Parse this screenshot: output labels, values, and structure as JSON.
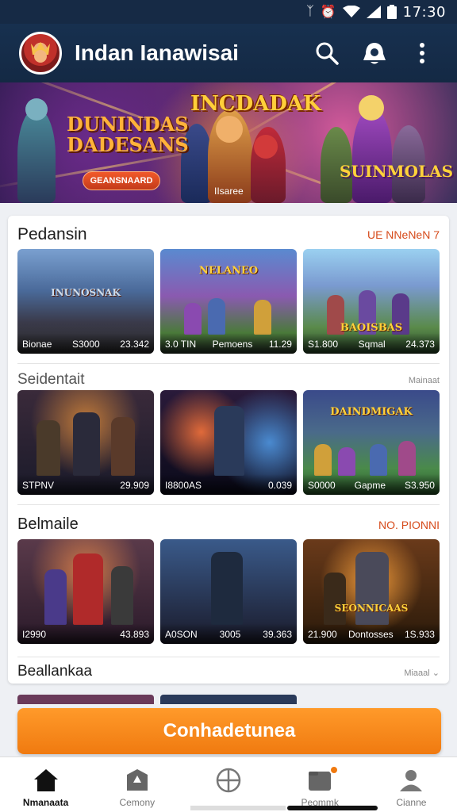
{
  "status": {
    "time": "17:30",
    "icons": [
      "bluetooth-icon",
      "alarm-icon",
      "wifi-icon",
      "signal-icon",
      "battery-icon"
    ]
  },
  "appbar": {
    "title": "Indan Ianawisai",
    "icons": [
      "search-icon",
      "notification-icon",
      "more-icon"
    ]
  },
  "banner": {
    "headline": "INCDADAK",
    "left_title": [
      "DUNINDAS",
      "DADESANS"
    ],
    "right_title": "SUINMOLAS",
    "button_label": "GEANSNAARD",
    "caption": "IIsaree"
  },
  "sections": [
    {
      "title": "Pedansin",
      "link": "UE NNeNeN 7",
      "tiles": [
        {
          "logo": "INUNOSNAK",
          "left": "Bionae",
          "mid": "S3000",
          "right": "23.342"
        },
        {
          "logo": "NELANEO",
          "left": "3.0 TIN",
          "mid": "Pemoens",
          "right": "11.29"
        },
        {
          "logo": "BAOISBAS",
          "left": "S1.800",
          "mid": "Sqmal",
          "right": "24.373"
        }
      ]
    },
    {
      "title": "Seidentait",
      "link": "Mainaat",
      "tiles": [
        {
          "logo": "",
          "left": "STPNV",
          "mid": "",
          "right": "29.909"
        },
        {
          "logo": "",
          "left": "I8800AS",
          "mid": "",
          "right": "0.039"
        },
        {
          "logo": "DAINDMIGAK",
          "left": "S0000",
          "mid": "Gapme",
          "right": "S3.950"
        }
      ]
    },
    {
      "title": "Belmaile",
      "link": "NO. PIONNI",
      "tiles": [
        {
          "logo": "",
          "left": "I2990",
          "mid": "",
          "right": "43.893"
        },
        {
          "logo": "",
          "left": "A0SON",
          "mid": "3005",
          "right": "39.363"
        },
        {
          "logo": "SEONNICAAS",
          "left": "21.900",
          "mid": "Dontosses",
          "right": "1S.933"
        }
      ]
    },
    {
      "title": "Beallankaa",
      "link": "Miaaal"
    }
  ],
  "cta": {
    "label": "Conhadetunea"
  },
  "tabs": [
    {
      "label": "Nmanaata",
      "icon": "home-icon",
      "active": true
    },
    {
      "label": "Cemony",
      "icon": "shield-icon",
      "active": false
    },
    {
      "label": "",
      "icon": "crosshair-icon",
      "active": false
    },
    {
      "label": "Peommk",
      "icon": "folder-icon",
      "active": false
    },
    {
      "label": "Cianne",
      "icon": "profile-icon",
      "active": false
    }
  ],
  "colors": {
    "appbar": "#17304f",
    "accent": "#f07a10",
    "link": "#d64a1a"
  }
}
